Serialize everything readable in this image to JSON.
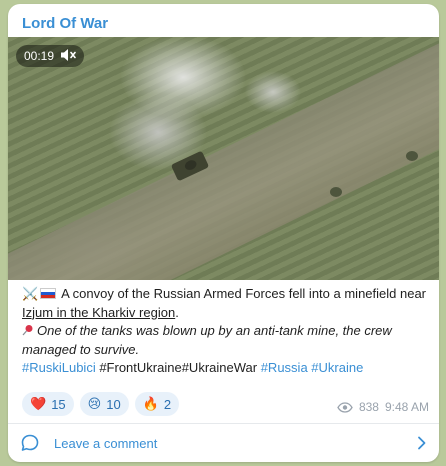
{
  "post": {
    "channel_name": "Lord Of War",
    "video": {
      "duration": "00:19"
    },
    "text": {
      "line1_part1": "A convoy of the Russian Armed Forces fell into a minefield near ",
      "line1_link": "Izjum in the Kharkiv region",
      "line1_end": ".",
      "line2": "One of the tanks was blown up by an anti-tank mine, the crew managed to survive.",
      "hashtags": [
        {
          "text": "#RuskiLubici",
          "linked": true
        },
        {
          "text": "#FrontUkraine#UkraineWar",
          "linked": false
        },
        {
          "text": "#Russia",
          "linked": true
        },
        {
          "text": "#Ukraine",
          "linked": true
        }
      ]
    },
    "reactions": [
      {
        "emoji": "❤️",
        "count": "15"
      },
      {
        "emoji": "😢",
        "count": "10"
      },
      {
        "emoji": "🔥",
        "count": "2"
      }
    ],
    "views": "838",
    "time": "9:48 AM",
    "comment_label": "Leave a comment"
  },
  "colors": {
    "accent": "#3a8fd4",
    "background": "#b9c99a"
  }
}
